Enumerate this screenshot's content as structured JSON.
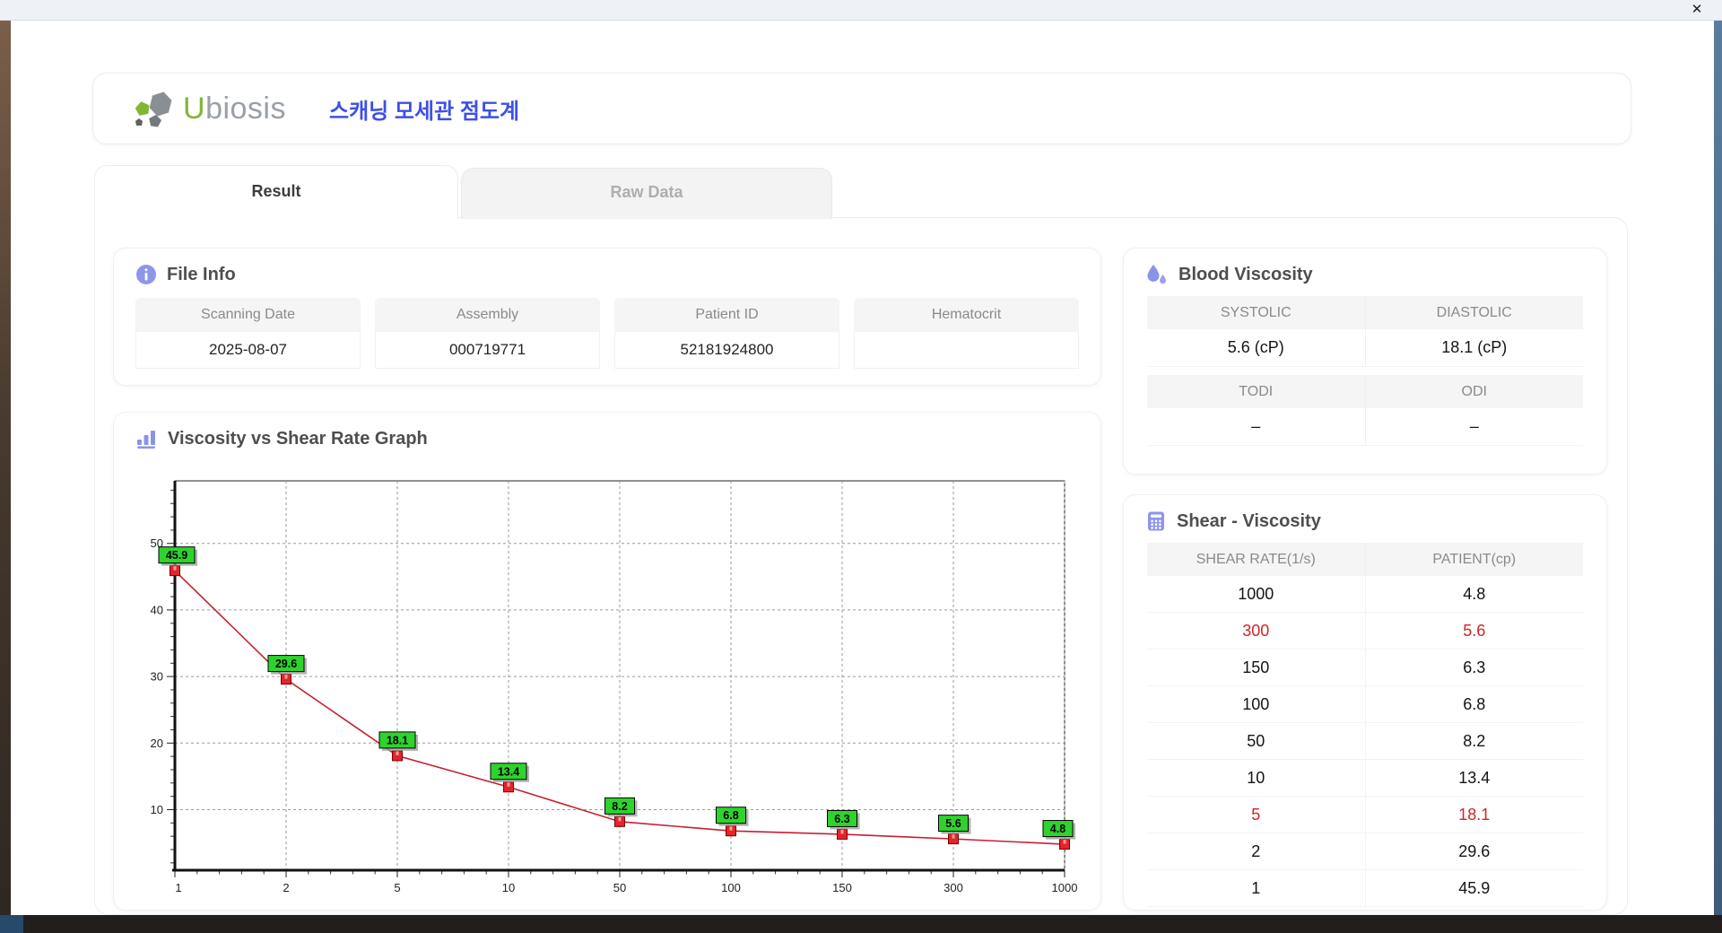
{
  "window": {
    "close_label": "✕"
  },
  "header": {
    "brand_u": "U",
    "brand_rest": "biosis",
    "title_ko": "스캐닝 모세관 점도계"
  },
  "tabs": {
    "result": "Result",
    "raw": "Raw Data"
  },
  "file_info": {
    "title": "File Info",
    "fields": [
      {
        "label": "Scanning Date",
        "value": "2025-08-07"
      },
      {
        "label": "Assembly",
        "value": "000719771"
      },
      {
        "label": "Patient ID",
        "value": "52181924800"
      },
      {
        "label": "Hematocrit",
        "value": ""
      }
    ]
  },
  "blood_viscosity": {
    "title": "Blood Viscosity",
    "rows": [
      {
        "h1": "SYSTOLIC",
        "h2": "DIASTOLIC",
        "v1": "5.6 (cP)",
        "v2": "18.1 (cP)"
      },
      {
        "h1": "TODI",
        "h2": "ODI",
        "v1": "–",
        "v2": "–"
      }
    ]
  },
  "shear_viscosity": {
    "title": "Shear - Viscosity",
    "col1": "SHEAR RATE(1/s)",
    "col2": "PATIENT(cp)",
    "rows": [
      {
        "rate": "1000",
        "value": "4.8",
        "highlight": false
      },
      {
        "rate": "300",
        "value": "5.6",
        "highlight": true
      },
      {
        "rate": "150",
        "value": "6.3",
        "highlight": false
      },
      {
        "rate": "100",
        "value": "6.8",
        "highlight": false
      },
      {
        "rate": "50",
        "value": "8.2",
        "highlight": false
      },
      {
        "rate": "10",
        "value": "13.4",
        "highlight": false
      },
      {
        "rate": "5",
        "value": "18.1",
        "highlight": true
      },
      {
        "rate": "2",
        "value": "29.6",
        "highlight": false
      },
      {
        "rate": "1",
        "value": "45.9",
        "highlight": false
      }
    ]
  },
  "chart_data": {
    "type": "line",
    "title": "Viscosity vs Shear Rate Graph",
    "xlabel": "",
    "ylabel": "",
    "x_scale": "categorical",
    "x": [
      "1",
      "2",
      "5",
      "10",
      "50",
      "100",
      "150",
      "300",
      "1000"
    ],
    "values": [
      45.9,
      29.6,
      18.1,
      13.4,
      8.2,
      6.8,
      6.3,
      5.6,
      4.8
    ],
    "point_labels": [
      "45.9",
      "29.6",
      "18.1",
      "13.4",
      "8.2",
      "6.8",
      "6.3",
      "5.6",
      "4.8"
    ],
    "y_ticks": [
      10,
      20,
      30,
      40,
      50
    ],
    "ylim": [
      0.9,
      59.4
    ],
    "grid": "dashed",
    "legend": "none",
    "colors": {
      "line": "#c81e32",
      "marker_fill": "#e3242b",
      "marker_stroke": "#7a0000",
      "label_bg": "#2ed32e",
      "label_border": "#000000",
      "grid": "#9a9a9a",
      "axis": "#111111"
    }
  }
}
